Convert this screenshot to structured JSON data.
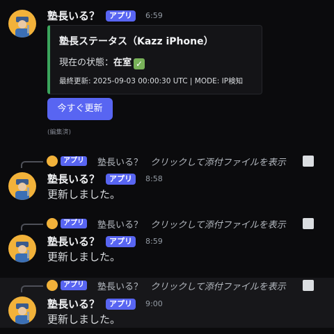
{
  "bot": {
    "name": "塾長いる？",
    "badge": "アプリ"
  },
  "first_message": {
    "time": "6:59",
    "embed": {
      "title": "塾長ステータス（Kazz iPhone）",
      "status_label": "現在の状態：",
      "status_value": "在室",
      "footer": "最終更新: 2025-09-03 00:00:30 UTC | MODE: IP検知"
    },
    "button_label": "今すぐ更新",
    "edited_label": "(編集済)"
  },
  "reply_link_text": "クリックして添付ファイルを表示",
  "replies": [
    {
      "time": "8:58",
      "text": "更新しました。"
    },
    {
      "time": "8:59",
      "text": "更新しました。"
    },
    {
      "time": "9:00",
      "text": "更新しました。"
    }
  ],
  "colors": {
    "accent": "#5865f2",
    "embed_border": "#3ba55c",
    "avatar_bg": "#f2b23a"
  }
}
